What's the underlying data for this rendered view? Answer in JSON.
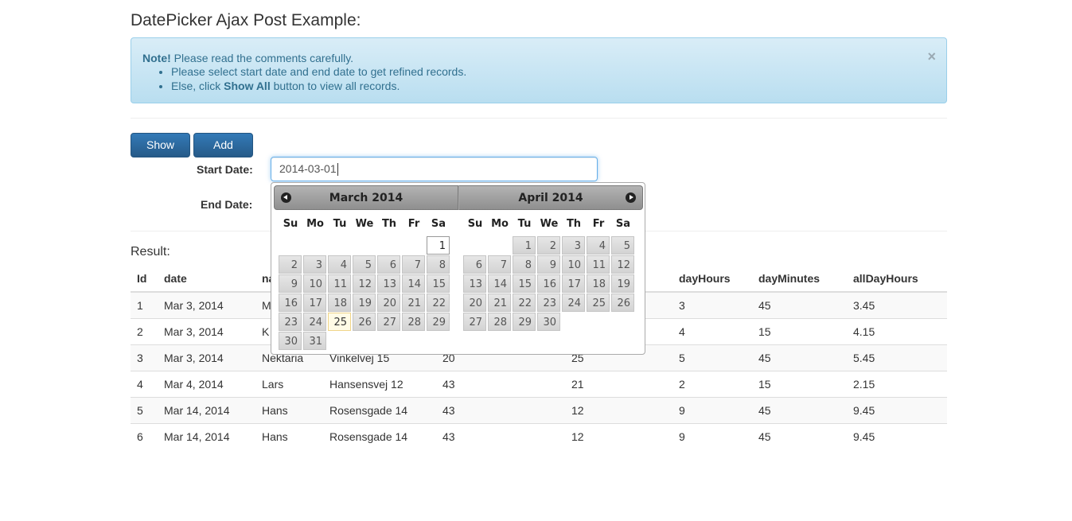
{
  "page": {
    "title": "DatePicker Ajax Post Example:"
  },
  "alert": {
    "note_strong": "Note!",
    "note_text": " Please read the comments carefully.",
    "item1": "Please select start date and end date to get refined records.",
    "item2_pre": "Else, click ",
    "item2_strong": "Show All",
    "item2_post": " button to view all records.",
    "close": "×"
  },
  "buttons": {
    "show_all": "Show All",
    "add_new": "Add New"
  },
  "form": {
    "start_label": "Start Date:",
    "start_value": "2014-03-01",
    "end_label": "End Date:"
  },
  "result": {
    "title": "Result:"
  },
  "table": {
    "headers": [
      "Id",
      "date",
      "na",
      "",
      "",
      "",
      "dayHours",
      "dayMinutes",
      "allDayHours"
    ],
    "rows": [
      [
        "1",
        "Mar 3, 2014",
        "M",
        "",
        "",
        "",
        "3",
        "45",
        "3.45"
      ],
      [
        "2",
        "Mar 3, 2014",
        "K",
        "",
        "",
        "",
        "4",
        "15",
        "4.15"
      ],
      [
        "3",
        "Mar 3, 2014",
        "Nektaria",
        "Vinkelvej 15",
        "20",
        "25",
        "5",
        "45",
        "5.45"
      ],
      [
        "4",
        "Mar 4, 2014",
        "Lars",
        "Hansensvej 12",
        "43",
        "21",
        "2",
        "15",
        "2.15"
      ],
      [
        "5",
        "Mar 14, 2014",
        "Hans",
        "Rosensgade 14",
        "43",
        "12",
        "9",
        "45",
        "9.45"
      ],
      [
        "6",
        "Mar 14, 2014",
        "Hans",
        "Rosensgade 14",
        "43",
        "12",
        "9",
        "45",
        "9.45"
      ]
    ]
  },
  "datepicker": {
    "weekdays": [
      "Su",
      "Mo",
      "Tu",
      "We",
      "Th",
      "Fr",
      "Sa"
    ],
    "months": [
      {
        "title": "March 2014",
        "first_weekday": 6,
        "days": 31,
        "active_day": 1,
        "today_day": 25
      },
      {
        "title": "April 2014",
        "first_weekday": 2,
        "days": 30,
        "active_day": null,
        "today_day": null
      }
    ]
  },
  "colors": {
    "primary": "#337ab7",
    "alert_bg": "#d9edf7",
    "alert_text": "#31708f"
  }
}
